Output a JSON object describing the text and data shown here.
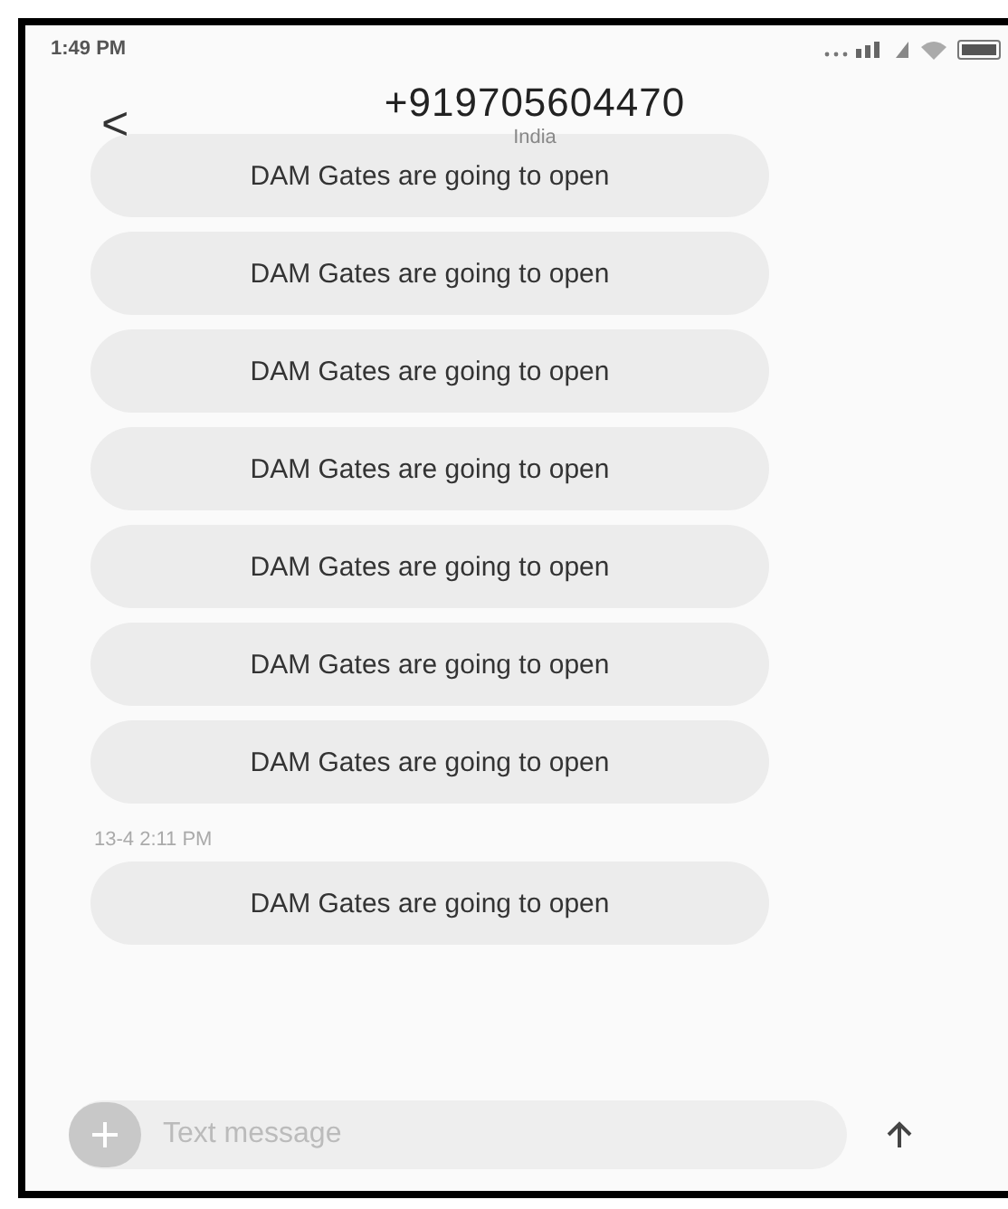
{
  "status_bar": {
    "time": "1:49 PM"
  },
  "header": {
    "back": "<",
    "title": "+919705604470",
    "subtitle": "India"
  },
  "messages": [
    {
      "kind": "bubble",
      "text": "DAM Gates are going to open"
    },
    {
      "kind": "bubble",
      "text": "DAM Gates are going to open"
    },
    {
      "kind": "bubble",
      "text": "DAM Gates are going to open"
    },
    {
      "kind": "bubble",
      "text": "DAM Gates are going to open"
    },
    {
      "kind": "bubble",
      "text": "DAM Gates are going to open"
    },
    {
      "kind": "bubble",
      "text": "DAM Gates are going to open"
    },
    {
      "kind": "bubble",
      "text": "DAM Gates are going to open"
    },
    {
      "kind": "timestamp",
      "text": "13-4 2:11 PM"
    },
    {
      "kind": "bubble",
      "text": "DAM Gates are going to open"
    }
  ],
  "composer": {
    "placeholder": "Text message"
  }
}
